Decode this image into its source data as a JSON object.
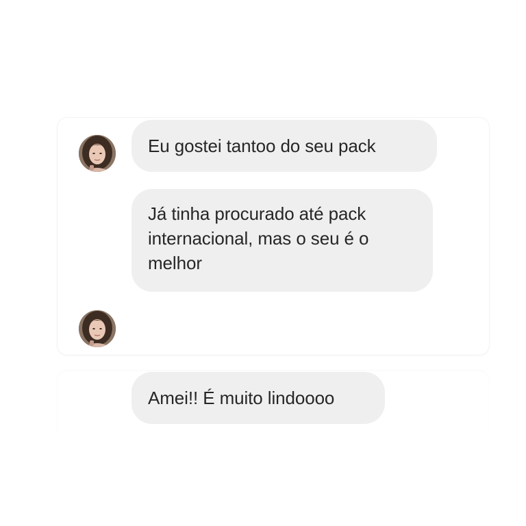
{
  "conversation": {
    "messages": [
      {
        "text": "Eu gostei tantoo do seu pack",
        "has_avatar": true
      },
      {
        "text": "Já tinha procurado até pack internacional, mas o seu é o melhor",
        "has_avatar": false
      },
      {
        "text": "Amei!! É muito lindoooo",
        "has_avatar": false
      }
    ],
    "typing_avatar": true
  },
  "colors": {
    "bubble_background": "#efefef",
    "text": "#262626",
    "page_background": "#ffffff"
  },
  "icons": {
    "avatar": "user-avatar-photo"
  }
}
